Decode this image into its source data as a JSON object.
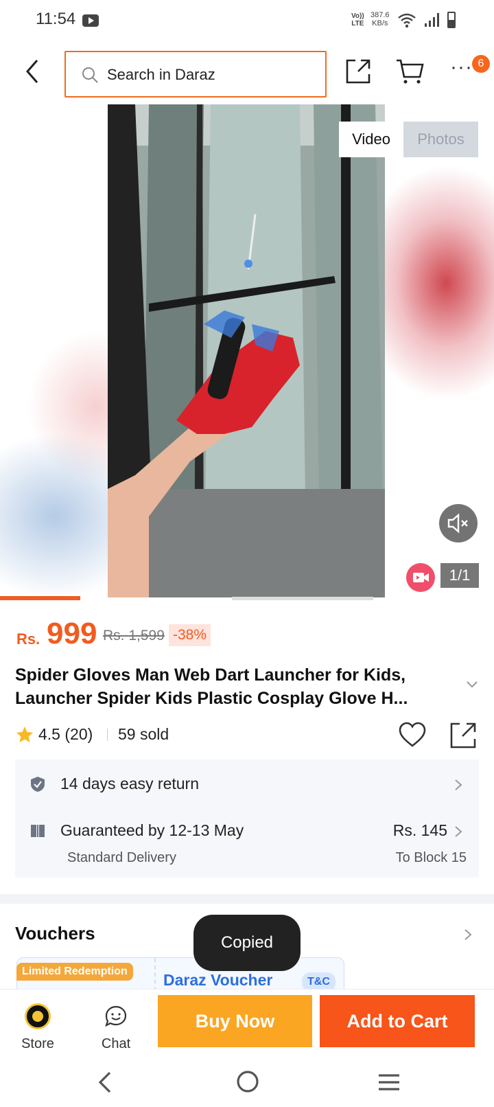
{
  "status_bar": {
    "time": "11:54",
    "network_label_1": "Vo))",
    "network_label_2": "LTE",
    "speed_value": "387.6",
    "speed_unit": "KB/s"
  },
  "header": {
    "search_placeholder": "Search in Daraz",
    "more_label": "···",
    "badge_count": "6"
  },
  "media": {
    "tab_video": "Video",
    "tab_photos": "Photos",
    "counter": "1/1"
  },
  "product": {
    "currency": "Rs.",
    "price": "999",
    "original_price": "Rs. 1,599",
    "discount": "-38%",
    "title_line1": "Spider Gloves Man Web Dart Launcher for Kids,",
    "title_line2": "Launcher Spider Kids Plastic Cosplay Glove H...",
    "rating": "4.5 (20)",
    "sold": "59 sold"
  },
  "service": {
    "return_text": "14 days easy return",
    "delivery_text": "Guaranteed by 12-13 May",
    "delivery_type": "Standard Delivery",
    "delivery_fee": "Rs. 145",
    "delivery_location": "To Block 15"
  },
  "vouchers": {
    "title": "Vouchers",
    "limited_label": "Limited Redemption",
    "voucher_name": "Daraz Voucher",
    "tc_label": "T&C"
  },
  "toast": {
    "text": "Copied"
  },
  "bottom_bar": {
    "store_label": "Store",
    "chat_label": "Chat",
    "buy_now": "Buy Now",
    "add_to_cart": "Add to Cart"
  },
  "colors": {
    "brand_orange": "#f25b1f",
    "buy_now_bg": "#fba622",
    "add_to_cart_bg": "#f7551a",
    "voucher_blue": "#2d6ee0"
  }
}
